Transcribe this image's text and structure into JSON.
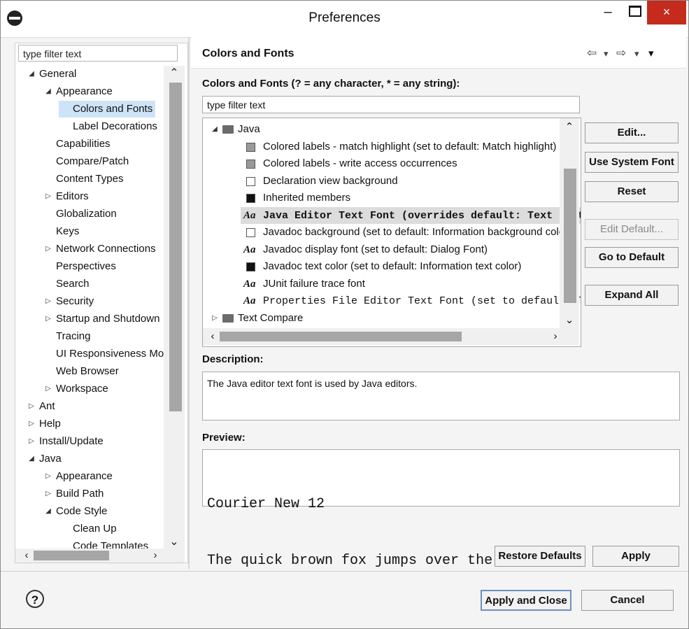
{
  "window": {
    "title": "Preferences",
    "minimize": "–",
    "close": "×"
  },
  "left_panel": {
    "filter_placeholder": "type filter text",
    "tree": [
      {
        "label": "General",
        "twisty": "expanded"
      },
      {
        "label": "Appearance",
        "twisty": "expanded"
      },
      {
        "label": "Colors and Fonts",
        "twisty": "none",
        "selected": true
      },
      {
        "label": "Label Decorations",
        "twisty": "none"
      },
      {
        "label": "Capabilities",
        "twisty": "none"
      },
      {
        "label": "Compare/Patch",
        "twisty": "none"
      },
      {
        "label": "Content Types",
        "twisty": "none"
      },
      {
        "label": "Editors",
        "twisty": "collapsed"
      },
      {
        "label": "Globalization",
        "twisty": "none"
      },
      {
        "label": "Keys",
        "twisty": "none"
      },
      {
        "label": "Network Connections",
        "twisty": "collapsed"
      },
      {
        "label": "Perspectives",
        "twisty": "none"
      },
      {
        "label": "Search",
        "twisty": "none"
      },
      {
        "label": "Security",
        "twisty": "collapsed"
      },
      {
        "label": "Startup and Shutdown",
        "twisty": "collapsed"
      },
      {
        "label": "Tracing",
        "twisty": "none"
      },
      {
        "label": "UI Responsiveness Monitoring",
        "twisty": "none"
      },
      {
        "label": "Web Browser",
        "twisty": "none"
      },
      {
        "label": "Workspace",
        "twisty": "collapsed"
      },
      {
        "label": "Ant",
        "twisty": "collapsed"
      },
      {
        "label": "Help",
        "twisty": "collapsed"
      },
      {
        "label": "Install/Update",
        "twisty": "collapsed"
      },
      {
        "label": "Java",
        "twisty": "expanded"
      },
      {
        "label": "Appearance",
        "twisty": "collapsed"
      },
      {
        "label": "Build Path",
        "twisty": "collapsed"
      },
      {
        "label": "Code Style",
        "twisty": "expanded"
      },
      {
        "label": "Clean Up",
        "twisty": "none"
      },
      {
        "label": "Code Templates",
        "twisty": "none"
      }
    ]
  },
  "page": {
    "title": "Colors and Fonts",
    "nav": {
      "back": "⇦",
      "back_menu": "▾",
      "forward": "⇨",
      "forward_menu": "▾",
      "view_menu": "▾"
    },
    "filter_label": "Colors and Fonts (? = any character, * = any string):",
    "filter_value": "type filter text",
    "tree": [
      {
        "label": "Java",
        "kind": "folder",
        "twisty": "expanded"
      },
      {
        "label": "Colored labels - match highlight (set to default: Match highlight)",
        "kind": "color",
        "swatch": "#9a9a9a"
      },
      {
        "label": "Colored labels - write access occurrences",
        "kind": "color",
        "swatch": "#9a9a9a"
      },
      {
        "label": "Declaration view background",
        "kind": "color",
        "swatch": "#ffffff"
      },
      {
        "label": "Inherited members",
        "kind": "color",
        "swatch": "#111111"
      },
      {
        "label": "Java Editor Text Font (overrides default: Text Font)",
        "kind": "font-mono",
        "selected": true
      },
      {
        "label": "Javadoc background (set to default: Information background color)",
        "kind": "color",
        "swatch": "#ffffff"
      },
      {
        "label": "Javadoc display font (set to default: Dialog Font)",
        "kind": "font"
      },
      {
        "label": "Javadoc text color (set to default: Information text color)",
        "kind": "color",
        "swatch": "#111111"
      },
      {
        "label": "JUnit failure trace font",
        "kind": "font"
      },
      {
        "label": "Properties File Editor Text Font (set to default: Text Font)",
        "kind": "font-mono"
      },
      {
        "label": "Text Compare",
        "kind": "folder",
        "twisty": "collapsed"
      }
    ],
    "font_icon": "Aa",
    "buttons": {
      "edit": "Edit...",
      "use_system_font": "Use System Font",
      "reset": "Reset",
      "edit_default": "Edit Default...",
      "go_to_default": "Go to Default",
      "expand_all": "Expand All"
    },
    "description_label": "Description:",
    "description_text": "The Java editor text font is used by Java editors.",
    "preview_label": "Preview:",
    "preview_lines": [
      "Courier New 12",
      "The quick brown fox jumps over the lazy dog."
    ],
    "restore_defaults": "Restore Defaults",
    "apply": "Apply"
  },
  "footer": {
    "help_icon": "?",
    "apply_and_close": "Apply and Close",
    "cancel": "Cancel"
  }
}
